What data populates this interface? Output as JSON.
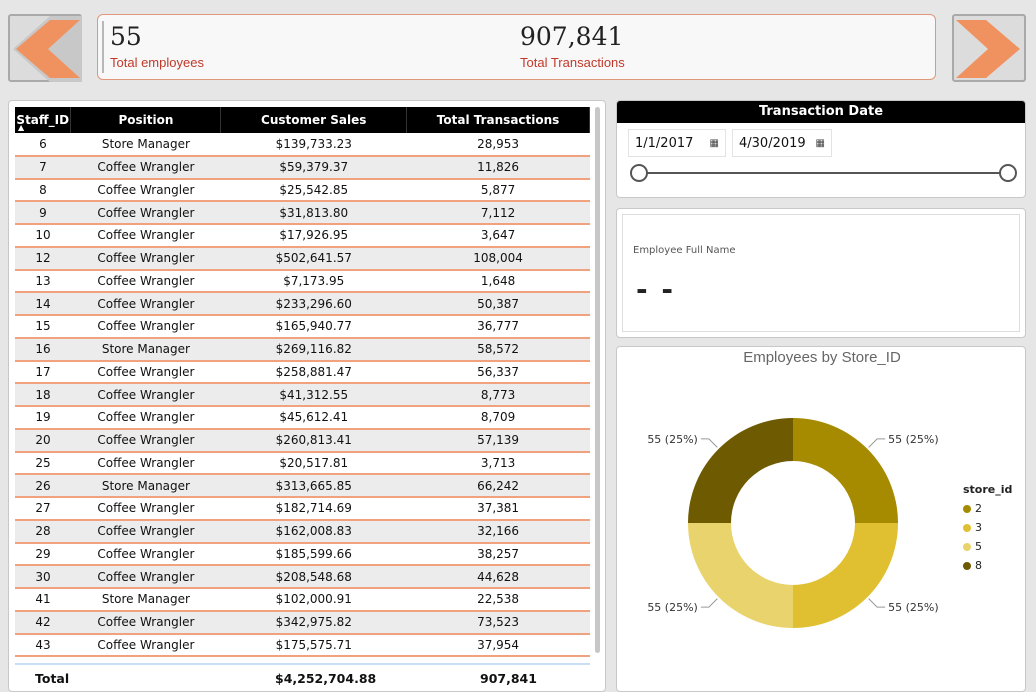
{
  "nav": {
    "prev_icon": "arrow-left-icon",
    "next_icon": "arrow-right-icon",
    "arrow_color": "#f0925f"
  },
  "kpis": {
    "total_employees": {
      "value": "55",
      "label": "Total employees"
    },
    "total_transactions": {
      "value": "907,841",
      "label": "Total Transactions"
    }
  },
  "table": {
    "columns": [
      "Staff_ID",
      "Position",
      "Customer Sales",
      "Total Transactions"
    ],
    "rows": [
      [
        "6",
        "Store Manager",
        "$139,733.23",
        "28,953"
      ],
      [
        "7",
        "Coffee Wrangler",
        "$59,379.37",
        "11,826"
      ],
      [
        "8",
        "Coffee Wrangler",
        "$25,542.85",
        "5,877"
      ],
      [
        "9",
        "Coffee Wrangler",
        "$31,813.80",
        "7,112"
      ],
      [
        "10",
        "Coffee Wrangler",
        "$17,926.95",
        "3,647"
      ],
      [
        "12",
        "Coffee Wrangler",
        "$502,641.57",
        "108,004"
      ],
      [
        "13",
        "Coffee Wrangler",
        "$7,173.95",
        "1,648"
      ],
      [
        "14",
        "Coffee Wrangler",
        "$233,296.60",
        "50,387"
      ],
      [
        "15",
        "Coffee Wrangler",
        "$165,940.77",
        "36,777"
      ],
      [
        "16",
        "Store Manager",
        "$269,116.82",
        "58,572"
      ],
      [
        "17",
        "Coffee Wrangler",
        "$258,881.47",
        "56,337"
      ],
      [
        "18",
        "Coffee Wrangler",
        "$41,312.55",
        "8,773"
      ],
      [
        "19",
        "Coffee Wrangler",
        "$45,612.41",
        "8,709"
      ],
      [
        "20",
        "Coffee Wrangler",
        "$260,813.41",
        "57,139"
      ],
      [
        "25",
        "Coffee Wrangler",
        "$20,517.81",
        "3,713"
      ],
      [
        "26",
        "Store Manager",
        "$313,665.85",
        "66,242"
      ],
      [
        "27",
        "Coffee Wrangler",
        "$182,714.69",
        "37,381"
      ],
      [
        "28",
        "Coffee Wrangler",
        "$162,008.83",
        "32,166"
      ],
      [
        "29",
        "Coffee Wrangler",
        "$185,599.66",
        "38,257"
      ],
      [
        "30",
        "Coffee Wrangler",
        "$208,548.68",
        "44,628"
      ],
      [
        "41",
        "Store Manager",
        "$102,000.91",
        "22,538"
      ],
      [
        "42",
        "Coffee Wrangler",
        "$342,975.82",
        "73,523"
      ],
      [
        "43",
        "Coffee Wrangler",
        "$175,575.71",
        "37,954"
      ]
    ],
    "total": {
      "label": "Total",
      "sales": "$4,252,704.88",
      "transactions": "907,841"
    },
    "sort_icon": "sort-ascending-icon"
  },
  "date_slicer": {
    "title": "Transaction Date",
    "start": "1/1/2017",
    "end": "4/30/2019",
    "calendar_icon": "calendar-icon"
  },
  "employee_card": {
    "label": "Employee Full Name",
    "value": "- -"
  },
  "chart_data": {
    "type": "pie",
    "title": "Employees by Store_ID",
    "legend_title": "store_id",
    "legend_position": "right",
    "categories": [
      "2",
      "3",
      "5",
      "8"
    ],
    "values": [
      55,
      55,
      55,
      55
    ],
    "labels": [
      "55 (25%)",
      "55 (25%)",
      "55 (25%)",
      "55 (25%)"
    ],
    "colors": [
      "#a68a00",
      "#e0c030",
      "#e9d36c",
      "#6e5a00"
    ],
    "donut": true
  }
}
